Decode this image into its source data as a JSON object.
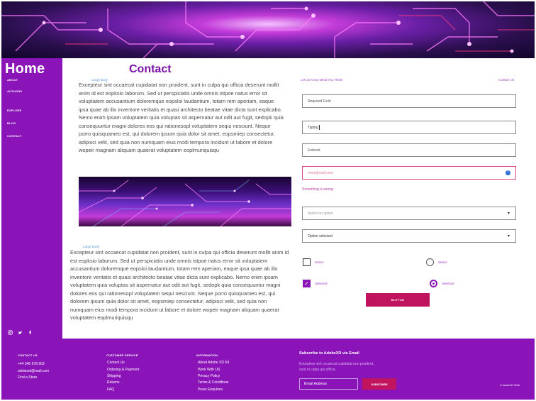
{
  "sidebar": {
    "title": "Home",
    "nav": [
      "ABOUT",
      "AUTHORS",
      "EXPLORE",
      "BLOG",
      "CONTACT"
    ],
    "socials": [
      "instagram-icon",
      "twitter-icon",
      "facebook-icon"
    ]
  },
  "main": {
    "title": "Contact",
    "caption_1": "Large Body",
    "caption_2": "Large Body",
    "paragraph_1": "Excepteur sint occaecat cupidatat non proident, sunt in culpa qui officia deserunt mollit anim id est eopksio laborum. Sed ut perspiciatis unde omnis istpoe natus error sit voluptatem accusantium doloremque eopsloi laudantium, totam rem aperiam, eaque ipsa quae ab illo inventore veritatis et quasi architecto beatae vitae dicta sunt explicabo. Nemo enim ipsam voluptatem quia voluptas sit aspernatur aut odit aut fugit, sedopk quia consequuntur magni dolores eos qui rationesopl voluptatem sequi nesciunt. Neque porro quisquameo est, qui dolorem ipsum quia dolor sit amet, eopsmiep consectetur, adipisci velit, sed quia non numquam eius modi tempora incidunt ut labore et dolore wopeir magnam aliquam quaerat voluptatem eoplmuriquisqu",
    "paragraph_2": "Excepteur sint occaecat cupidatat non proident, sunt in culpa qui officia deserunt mollit anim id est eopksio laborum. Sed ut perspiciatis unde omnis istpoe natus error sit voluptatem accusantium doloremque eopsloi laudantium, totam rem aperiam, eaque ipsa quae ab illo inventore veritatis et quasi architecto beatae vitae dicta sunt explicabo. Nemo enim ipsam voluptatem quia voluptas sit aspernatur aut odit aut fugit, sedopk quia consequuntur magni dolores eos qui rationesopl voluptatem sequi nesciunt. Neque porro quisquameo est, qui dolorem ipsum quia dolor sit amet, eopsmiep consectetur, adipisci velit, sed quia non numquam eius modi tempora incidunt ut labore et dolore wopeir magnam aliquam quaerat voluptatem eoplmuriquisqu"
  },
  "form": {
    "intro": "Let Us Know What You Think!",
    "contact_link": "Contact Us",
    "field_required": "Required Field",
    "field_typing": "Typing",
    "field_entered": "Entered",
    "field_error_value": "error@mail.com",
    "error_message": "Something is wrong",
    "select_placeholder": "Select an option",
    "select_selected": "Option selected",
    "checkbox_unselected": "Select",
    "checkbox_selected": "Selected",
    "radio_unselected": "Select",
    "radio_selected": "Selected",
    "button": "BUTTON"
  },
  "footer": {
    "contact": {
      "title": "CONTACT US",
      "phone": "+44 345 678 903",
      "email": "adobexd@mail.com",
      "store": "Find a Store"
    },
    "customer_service": {
      "title": "CUSTOMER SERVICE",
      "items": [
        "Contact Us",
        "Ordering & Payment",
        "Shipping",
        "Returns",
        "FAQ"
      ]
    },
    "information": {
      "title": "INFORMATION",
      "items": [
        "About Adobe XD Kit",
        "Work With US",
        "Privacy Policy",
        "Terms & Conditions",
        "Press Enquiries"
      ]
    },
    "subscribe": {
      "title": "Subscribe to AdobeXD via Email",
      "text": "Excepteur sint occaecat cupidatat non proident, sunt in culpa qui officia.",
      "placeholder": "Email Address",
      "button": "SUBSCRIBE"
    },
    "copyright": "© AdobeXD 2018"
  }
}
